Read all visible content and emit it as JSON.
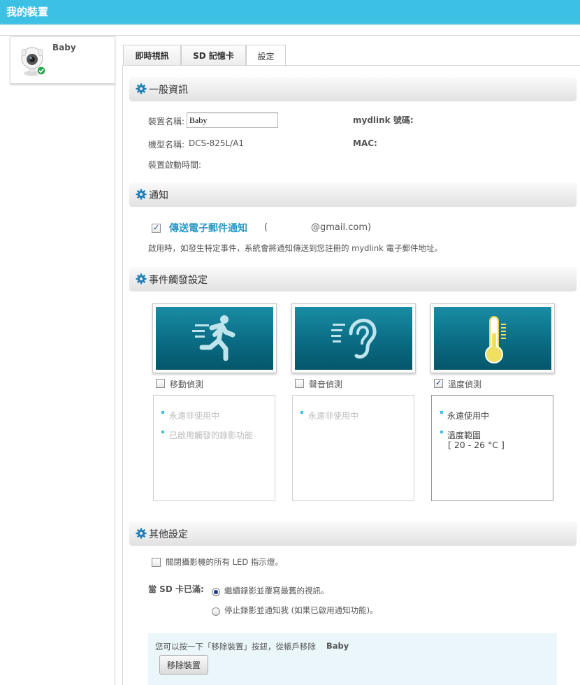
{
  "header": {
    "title": "我的裝置"
  },
  "device": {
    "name": "Baby"
  },
  "tabs": [
    {
      "label": "即時視訊",
      "active": false
    },
    {
      "label": "SD 記憶卡",
      "active": false
    },
    {
      "label": "設定",
      "active": true
    }
  ],
  "general": {
    "title": "一般資訊",
    "device_name_label": "裝置名稱:",
    "device_name_value": "Baby",
    "model_label": "機型名稱:",
    "model_value": "DCS-825L/A1",
    "uptime_label": "裝置啟動時間:",
    "mydlink_label": "mydlink 號碼:",
    "mac_label": "MAC:"
  },
  "notify": {
    "title": "通知",
    "email_label": "傳送電子郵件通知",
    "email_checked": true,
    "email_open": "(",
    "email_address": "@gmail.com)",
    "description": "啟用時，如發生特定事件，系統會將通知傳送到您註冊的 mydlink 電子郵件地址。"
  },
  "triggers": {
    "title": "事件觸發設定",
    "items": [
      {
        "label": "移動偵測",
        "checked": false,
        "icon": "running-man-icon",
        "bullets": [
          "永遠非使用中",
          "已啟用觸發的錄影功能"
        ],
        "active": false
      },
      {
        "label": "聲音偵測",
        "checked": false,
        "icon": "ear-icon",
        "bullets": [
          "永遠非使用中"
        ],
        "active": false
      },
      {
        "label": "溫度偵測",
        "checked": true,
        "icon": "thermometer-icon",
        "bullets": [
          "永遠使用中",
          "溫度範圍"
        ],
        "range": "[ 20 - 26 °C ]",
        "active": true
      }
    ]
  },
  "other": {
    "title": "其他設定",
    "led_label": "關閉攝影機的所有 LED 指示燈。",
    "led_checked": false,
    "sd_full_label": "當 SD 卡已滿:",
    "options": [
      {
        "label": "繼續錄影並覆寫最舊的視訊。",
        "selected": true
      },
      {
        "label": "停止錄影並通知我 (如果已啟用通知功能)。",
        "selected": false
      }
    ]
  },
  "remove": {
    "text_prefix": "您可以按一下「移除裝置」按鈕，從帳戶移除",
    "device": "Baby",
    "button": "移除裝置"
  },
  "colors": {
    "accent": "#3cc0e4",
    "link": "#2a99c6",
    "tile": "#0a6c84"
  }
}
